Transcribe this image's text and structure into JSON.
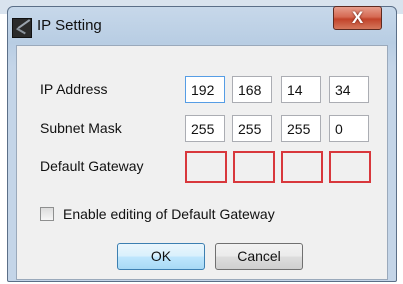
{
  "window": {
    "title": "IP Setting",
    "close_label": "X"
  },
  "ip_address": {
    "label": "IP Address",
    "octets": [
      "192",
      "168",
      "14",
      "34"
    ]
  },
  "subnet_mask": {
    "label": "Subnet Mask",
    "octets": [
      "255",
      "255",
      "255",
      "0"
    ]
  },
  "default_gateway": {
    "label": "Default Gateway",
    "octets": [
      "",
      "",
      "",
      ""
    ]
  },
  "enable_gateway_editing": {
    "label": "Enable editing of Default Gateway",
    "checked": false
  },
  "buttons": {
    "ok": "OK",
    "cancel": "Cancel"
  }
}
